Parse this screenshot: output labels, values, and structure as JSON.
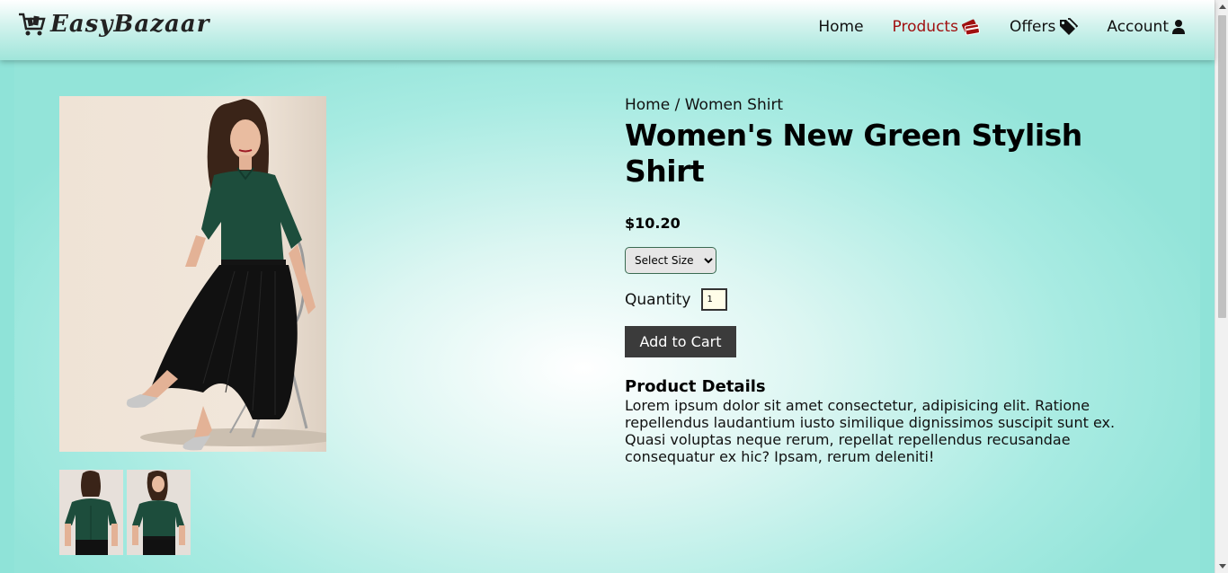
{
  "header": {
    "brand": "EasyBazaar",
    "nav": [
      {
        "label": "Home",
        "icon": ""
      },
      {
        "label": "Products",
        "icon": "credit-card-icon"
      },
      {
        "label": "Offers",
        "icon": "tag-icon"
      },
      {
        "label": "Account",
        "icon": "user-icon"
      }
    ],
    "active_color": "#a01010"
  },
  "product": {
    "breadcrumb": "Home / Women Shirt",
    "title": "Women's New Green Stylish Shirt",
    "price": "$10.20",
    "size_select": "Select Size",
    "quantity_label": "Quantity",
    "quantity_value": "1",
    "add_to_cart": "Add to Cart",
    "details_title": "Product Details",
    "details_text": "Lorem ipsum dolor sit amet consectetur, adipisicing elit. Ratione repellendus laudantium iusto similique dignissimos suscipit sunt ex. Quasi voluptas neque rerum, repellat repellendus recusandae consequatur ex hic? Ipsam, rerum deleniti!"
  },
  "colors": {
    "shirt_green": "#1d4d3c",
    "skirt_black": "#111111",
    "button_bg": "#3b3b3b"
  }
}
